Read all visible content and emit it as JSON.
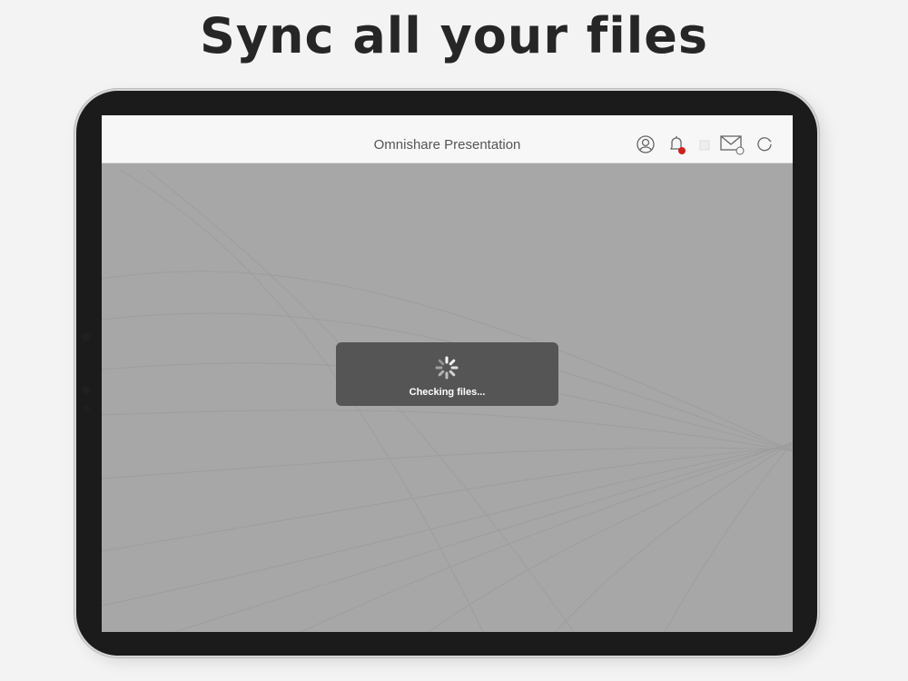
{
  "headline": "Sync all your files",
  "app": {
    "title": "Omnishare Presentation",
    "toolbar_icons": [
      "user-icon",
      "bell-icon",
      "mail-icon",
      "refresh-icon"
    ],
    "notification_badge_color": "#cc2222",
    "mail_badge": "0"
  },
  "loading": {
    "message": "Checking files...",
    "icon": "spinner-icon"
  },
  "colors": {
    "background": "#f3f3f3",
    "screen": "#a7a7a7",
    "navbar": "#f7f7f7",
    "overlay": "#555555"
  }
}
